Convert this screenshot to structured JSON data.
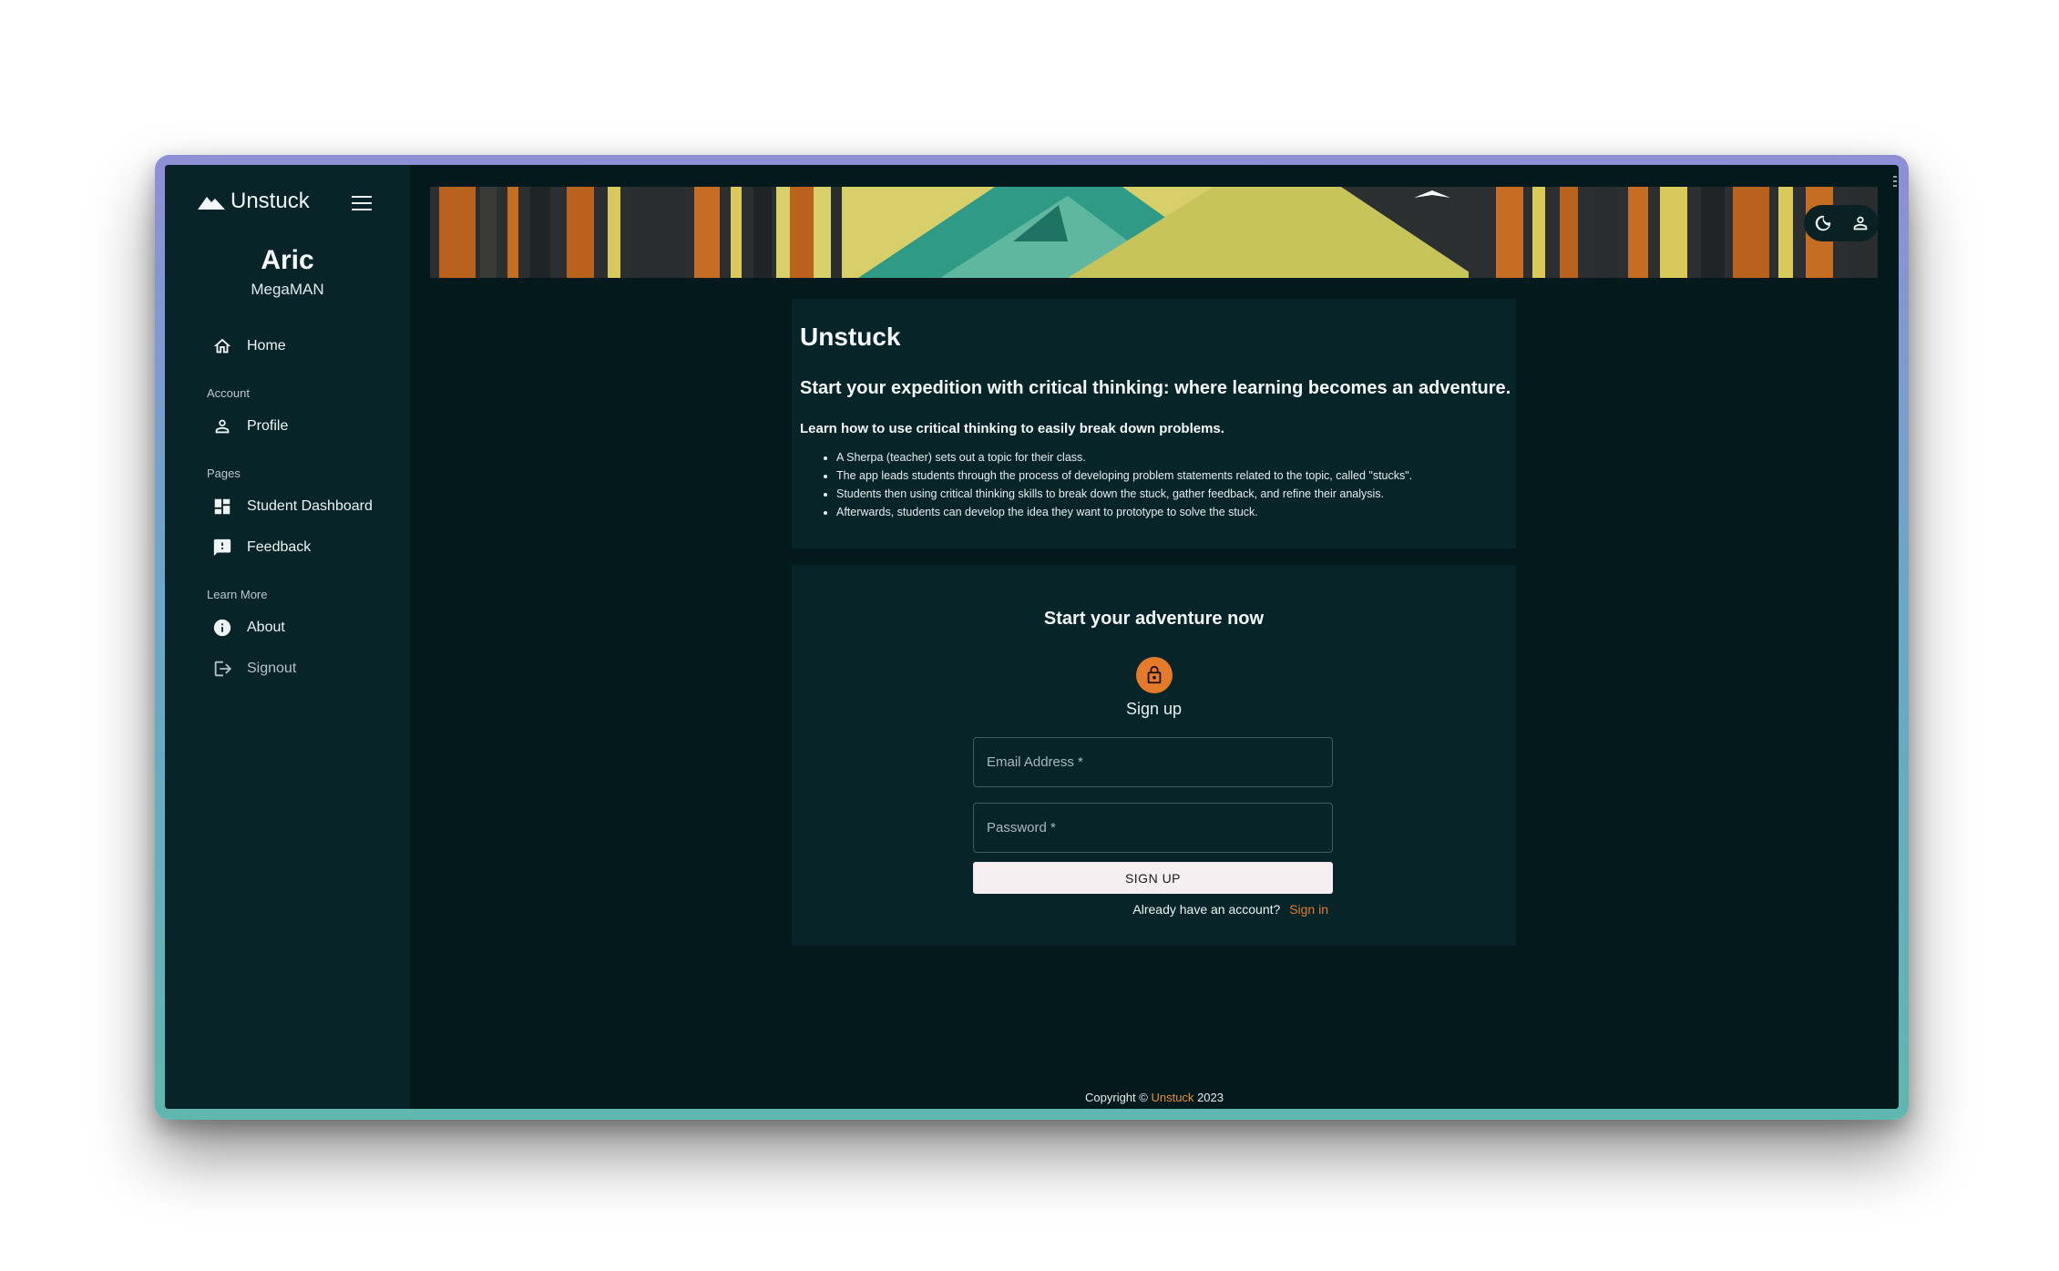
{
  "sidebar": {
    "brand": "Unstuck",
    "user_name": "Aric",
    "user_role": "MegaMAN",
    "items": [
      {
        "label": "Home",
        "icon": "home-icon"
      },
      {
        "section": "Account"
      },
      {
        "label": "Profile",
        "icon": "person-icon"
      },
      {
        "section": "Pages"
      },
      {
        "label": "Student Dashboard",
        "icon": "dashboard-icon"
      },
      {
        "label": "Feedback",
        "icon": "feedback-icon"
      },
      {
        "section": "Learn More"
      },
      {
        "label": "About",
        "icon": "info-icon"
      },
      {
        "label": "Signout",
        "icon": "logout-icon"
      }
    ]
  },
  "header": {
    "actions": [
      "dark-mode-icon",
      "account-icon"
    ]
  },
  "intro": {
    "title": "Unstuck",
    "headline": "Start your expedition with critical thinking: where learning becomes an adventure.",
    "lead": "Learn how to use critical thinking to easily break down problems.",
    "bullets": [
      "A Sherpa (teacher) sets out a topic for their class.",
      "The app leads students through the process of developing problem statements related to the topic, called \"stucks\".",
      "Students then using critical thinking skills to break down the stuck, gather feedback, and refine their analysis.",
      "Afterwards, students can develop the idea they want to prototype to solve the stuck."
    ]
  },
  "signup": {
    "title": "Start your adventure now",
    "subtitle": "Sign up",
    "email_placeholder": "Email Address *",
    "password_placeholder": "Password *",
    "button_label": "SIGN UP",
    "already_text": "Already have an account?",
    "signin_link": "Sign in"
  },
  "footer": {
    "prefix": "Copyright ©",
    "link": "Unstuck",
    "year": "2023"
  },
  "colors": {
    "background": "#04191c",
    "sidebar": "#082429",
    "card": "#072428",
    "accent": "#e57b2a"
  }
}
